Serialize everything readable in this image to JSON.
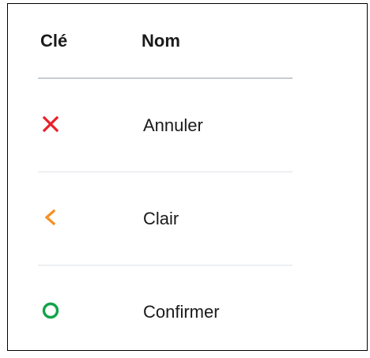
{
  "table": {
    "headers": {
      "key": "Clé",
      "name": "Nom"
    },
    "rows": [
      {
        "label": "Annuler",
        "icon": "close-icon",
        "color": "#e8202a"
      },
      {
        "label": "Clair",
        "icon": "chevron-left-icon",
        "color": "#f5901e"
      },
      {
        "label": "Confirmer",
        "icon": "circle-icon",
        "color": "#13a34a"
      }
    ]
  }
}
